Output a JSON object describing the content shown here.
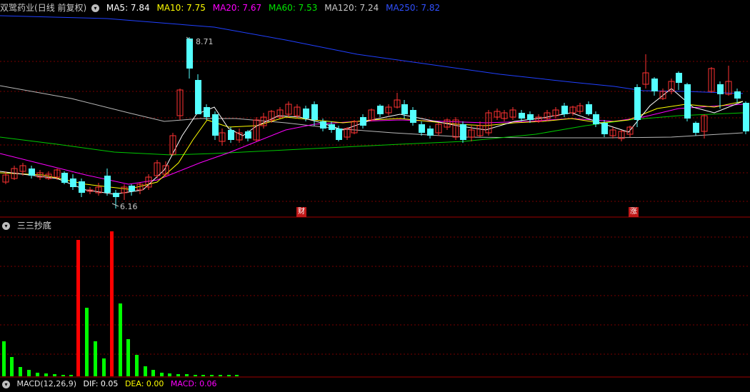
{
  "main_panel": {
    "stock_name": "双鹭药业",
    "period_label": "(日线 前复权)",
    "ma": [
      {
        "label": "MA5",
        "value": "7.84",
        "color": "#ffffff"
      },
      {
        "label": "MA10",
        "value": "7.75",
        "color": "#ffff00"
      },
      {
        "label": "MA20",
        "value": "7.67",
        "color": "#ff00ff"
      },
      {
        "label": "MA60",
        "value": "7.53",
        "color": "#00e600"
      },
      {
        "label": "MA120",
        "value": "7.24",
        "color": "#c8c8c8"
      },
      {
        "label": "MA250",
        "value": "7.82",
        "color": "#3050ff"
      }
    ],
    "high_mark": "8.71",
    "low_mark": "6.16",
    "event_tags": [
      "财",
      "涨"
    ]
  },
  "indicator_panel": {
    "title": "三三抄底"
  },
  "macd_panel": {
    "title": "MACD(12,26,9)",
    "dif": "DIF: 0.05",
    "dea": "DEA: 0.00",
    "macd": "MACD: 0.06"
  },
  "colors": {
    "up": "#ff3232",
    "down": "#54ffff",
    "grid": "#7a0000",
    "ind_green": "#00ff00",
    "ind_red": "#ff0000"
  },
  "icons": [
    "dropdown-icon"
  ]
}
